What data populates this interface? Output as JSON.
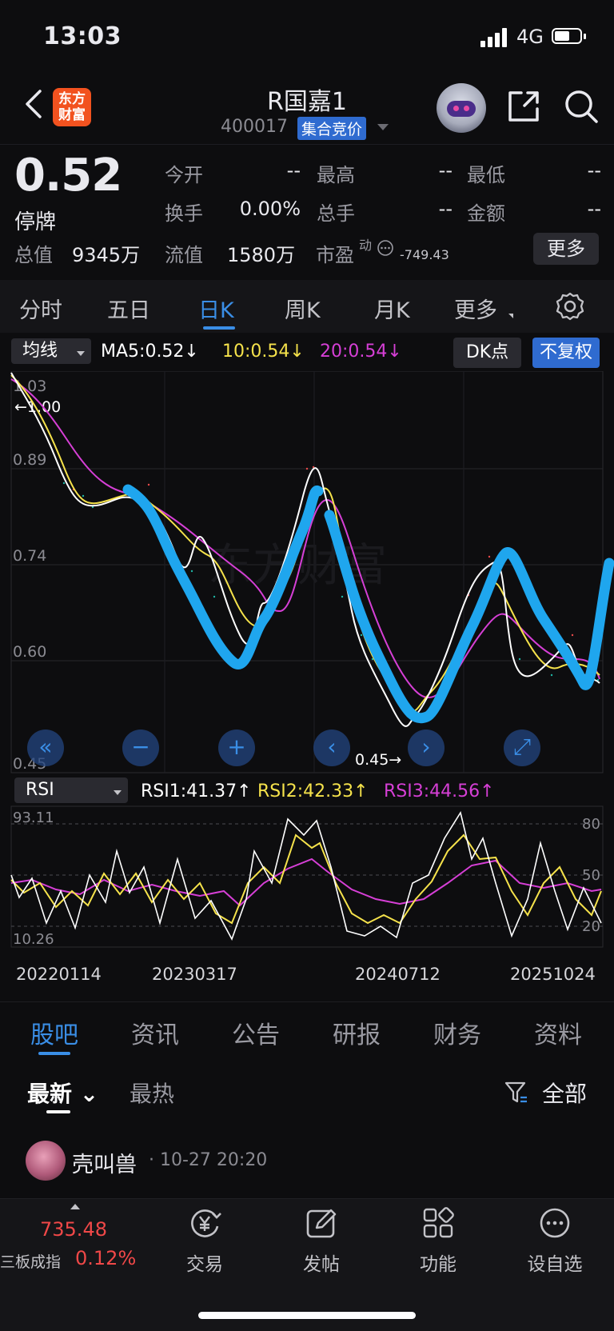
{
  "status": {
    "time": "13:03",
    "network": "4G"
  },
  "nav": {
    "title": "R国嘉1",
    "code": "400017",
    "auction_badge": "集合竞价",
    "logo_line1": "东方",
    "logo_line2": "财富"
  },
  "quote": {
    "price": "0.52",
    "state": "停牌",
    "rows": [
      {
        "l1": "今开",
        "v1": "--",
        "l2": "最高",
        "v2": "--",
        "l3": "最低",
        "v3": "--"
      },
      {
        "l1": "换手",
        "v1": "0.00%",
        "l2": "总手",
        "v2": "--",
        "l3": "金额",
        "v3": "--"
      }
    ],
    "total_value_label": "总值",
    "total_value": "9345万",
    "float_value_label": "流值",
    "float_value": "1580万",
    "pe_label": "市盈",
    "pe_dyn": "动",
    "pe_value": "-749.43",
    "more": "更多"
  },
  "period_tabs": [
    "分时",
    "五日",
    "日K",
    "周K",
    "月K",
    "更多"
  ],
  "active_period": "日K",
  "ma_bar": {
    "select": "均线",
    "ma5": "MA5:0.52↓",
    "ma10": "10:0.54↓",
    "ma20": "20:0.54↓",
    "dk": "DK点",
    "adjust": "不复权",
    "color_ma5": "#ffffff",
    "color_ma10": "#f5e24b",
    "color_ma20": "#d63fd6"
  },
  "kline": {
    "y_labels": [
      "1.03",
      "0.89",
      "0.74",
      "0.60",
      "0.45"
    ],
    "max_marker": "←1.00",
    "min_marker": "0.45→",
    "watermark": "东方财富"
  },
  "rsi_bar": {
    "select": "RSI",
    "rsi1": "RSI1:41.37↑",
    "rsi2": "RSI2:42.33↑",
    "rsi3": "RSI3:44.56↑"
  },
  "rsi_axis": {
    "left_top": "93.11",
    "left_bottom": "10.26",
    "right": [
      "80",
      "50",
      "20"
    ]
  },
  "dates": [
    "20220114",
    "20230317",
    "20240712",
    "20251024"
  ],
  "sub_tabs": [
    "股吧",
    "资讯",
    "公告",
    "研报",
    "财务",
    "资料"
  ],
  "active_sub_tab": "股吧",
  "feed_filter": {
    "newest": "最新",
    "hottest": "最热",
    "all": "全部"
  },
  "post": {
    "user": "壳叫兽",
    "meta": "· 10-27 20:20"
  },
  "bottom": {
    "index_value": "735.48",
    "index_name": "三板成指",
    "index_change": "0.12%",
    "items": [
      "交易",
      "发帖",
      "功能",
      "设自选"
    ]
  },
  "chart_data": {
    "type": "line",
    "panels": [
      "daily-kline-ma",
      "rsi"
    ],
    "ma_series": [
      {
        "name": "MA5",
        "last": 0.52,
        "color": "#ffffff"
      },
      {
        "name": "10",
        "last": 0.54,
        "color": "#f5e24b"
      },
      {
        "name": "20",
        "last": 0.54,
        "color": "#d63fd6"
      }
    ],
    "price_axis": [
      0.45,
      0.6,
      0.74,
      0.89,
      1.03
    ],
    "price_high": 1.0,
    "price_low": 0.45,
    "rsi_series": [
      {
        "name": "RSI1",
        "last": 41.37
      },
      {
        "name": "RSI2",
        "last": 42.33
      },
      {
        "name": "RSI3",
        "last": 44.56
      }
    ],
    "rsi_range": [
      10.26,
      93.11
    ],
    "x_ticks": [
      "20220114",
      "20230317",
      "20240712",
      "20251024"
    ]
  }
}
